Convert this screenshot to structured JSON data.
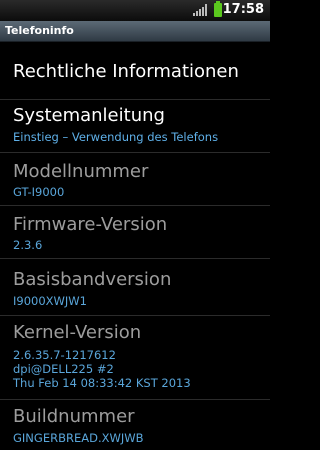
{
  "status_bar": {
    "time": "17:58",
    "signal_icon": "signal-bars-icon",
    "battery_icon": "battery-icon",
    "battery_color": "#5bc81e"
  },
  "title_bar": {
    "title": "Telefoninfo"
  },
  "items": [
    {
      "label": "Rechtliche Informationen"
    },
    {
      "label": "Systemanleitung",
      "value": "Einstieg – Verwendung des Telefons"
    },
    {
      "label": "Modellnummer",
      "value": "GT-I9000"
    },
    {
      "label": "Firmware-Version",
      "value": "2.3.6"
    },
    {
      "label": "Basisbandversion",
      "value": "I9000XWJW1"
    },
    {
      "label": "Kernel-Version",
      "value_lines": [
        "2.6.35.7-1217612",
        "dpi@DELL225 #2",
        "Thu Feb 14 08:33:42 KST 2013"
      ]
    },
    {
      "label": "Buildnummer",
      "value": "GINGERBREAD.XWJWB"
    }
  ],
  "colors": {
    "accent_text": "#5fb0e8",
    "disabled_label": "#9d9d9d",
    "background": "#000000"
  }
}
